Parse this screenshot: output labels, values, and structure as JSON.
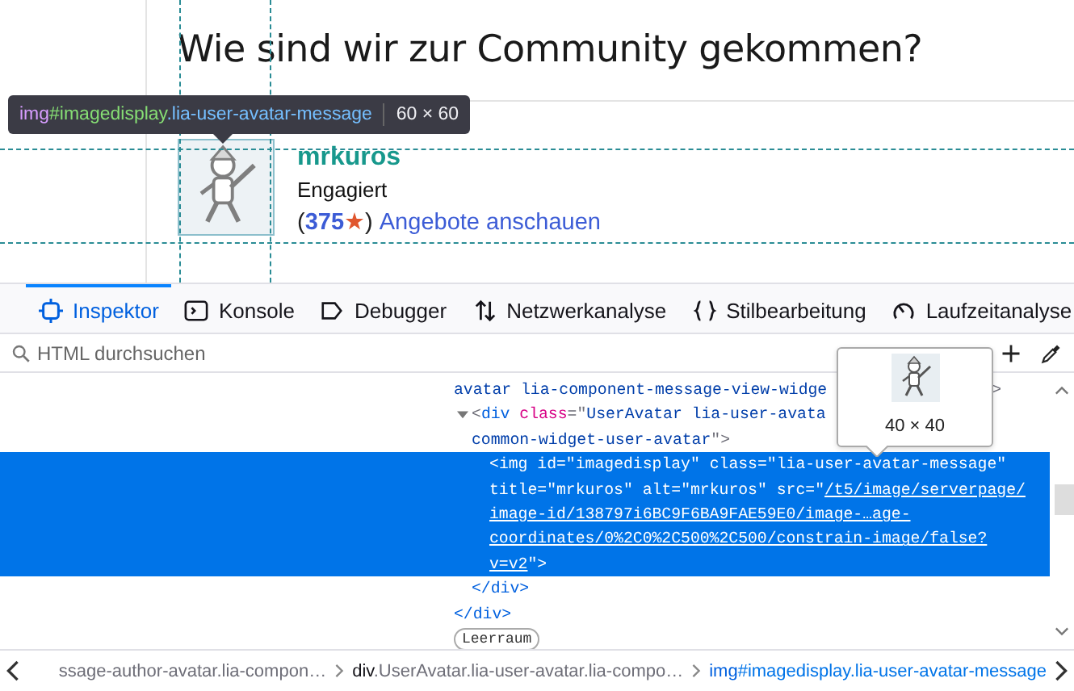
{
  "page": {
    "heading": "Wie sind wir zur Community gekommen?",
    "author": {
      "name": "mrkuros",
      "rank": "Engagiert",
      "open_paren": "(",
      "points": "375",
      "star": "★",
      "close_paren": ")",
      "link": "Angebote anschauen"
    }
  },
  "infobar": {
    "tag": "img",
    "id": "#imagedisplay",
    "classes": ".lia-user-avatar-message",
    "size": "60 × 60"
  },
  "toolbar": {
    "tabs": [
      {
        "label": "Inspektor",
        "selected": true
      },
      {
        "label": "Konsole",
        "selected": false
      },
      {
        "label": "Debugger",
        "selected": false
      },
      {
        "label": "Netzwerkanalyse",
        "selected": false
      },
      {
        "label": "Stilbearbeitung",
        "selected": false
      },
      {
        "label": "Laufzeitanalyse",
        "selected": false
      }
    ]
  },
  "search": {
    "placeholder": "HTML durchsuchen"
  },
  "markup": [
    {
      "lines": [
        [
          {
            "kind": "value",
            "text": "avatar lia-component-message-view-widge"
          },
          {
            "kind": "tail",
            "text": ">"
          }
        ]
      ],
      "close": "</div>",
      "children": [
        {
          "expanded": true,
          "selected": false,
          "lines": [
            [
              {
                "kind": "punct",
                "text": "<"
              },
              {
                "kind": "tag",
                "text": "div"
              },
              {
                "kind": "attr",
                "text": " class"
              },
              {
                "kind": "punct",
                "text": "=\""
              },
              {
                "kind": "value",
                "text": "UserAvatar lia-user-avata"
              }
            ],
            [
              {
                "kind": "value",
                "text": "common-widget-user-avatar"
              },
              {
                "kind": "punct",
                "text": "\">"
              }
            ]
          ],
          "close": "</div>",
          "children": [
            {
              "selected": true,
              "lines": [
                [
                  {
                    "kind": "punct",
                    "text": "<"
                  },
                  {
                    "kind": "tag",
                    "text": "img"
                  },
                  {
                    "kind": "attr",
                    "text": " id"
                  },
                  {
                    "kind": "punct",
                    "text": "=\""
                  },
                  {
                    "kind": "value",
                    "text": "imagedisplay"
                  },
                  {
                    "kind": "punct",
                    "text": "\""
                  },
                  {
                    "kind": "attr",
                    "text": " class"
                  },
                  {
                    "kind": "punct",
                    "text": "=\""
                  },
                  {
                    "kind": "value",
                    "text": "lia-user-avatar-message"
                  },
                  {
                    "kind": "punct",
                    "text": "\""
                  }
                ],
                [
                  {
                    "kind": "attr",
                    "text": "title"
                  },
                  {
                    "kind": "punct",
                    "text": "=\""
                  },
                  {
                    "kind": "value",
                    "text": "mrkuros"
                  },
                  {
                    "kind": "punct",
                    "text": "\""
                  },
                  {
                    "kind": "attr",
                    "text": " alt"
                  },
                  {
                    "kind": "punct",
                    "text": "=\""
                  },
                  {
                    "kind": "value",
                    "text": "mrkuros"
                  },
                  {
                    "kind": "punct",
                    "text": "\""
                  },
                  {
                    "kind": "attr",
                    "text": " src"
                  },
                  {
                    "kind": "punct",
                    "text": "=\""
                  },
                  {
                    "kind": "link",
                    "text": "/t5/image/serverpage/"
                  }
                ],
                [
                  {
                    "kind": "link",
                    "text": "image-id/138797i6BC9F6BA9FAE59E0/image-…age-"
                  }
                ],
                [
                  {
                    "kind": "link",
                    "text": "coordinates/0%2C0%2C500%2C500/constrain-image/false?"
                  }
                ],
                [
                  {
                    "kind": "link",
                    "text": "v=v2"
                  },
                  {
                    "kind": "punct",
                    "text": "\">"
                  }
                ]
              ]
            }
          ]
        }
      ]
    },
    {
      "kind": "whitespace",
      "label": "Leerraum"
    }
  ],
  "image_tooltip": {
    "size": "40 × 40"
  },
  "breadcrumbs": [
    {
      "rest": "ssage-author-avatar.lia-compon…",
      "selected": false
    },
    {
      "tag": "div",
      "rest": ".UserAvatar.lia-user-avatar.lia-compo…",
      "selected": false
    },
    {
      "tag": "img",
      "rest": "#imagedisplay.lia-user-avatar-message",
      "selected": true
    }
  ]
}
